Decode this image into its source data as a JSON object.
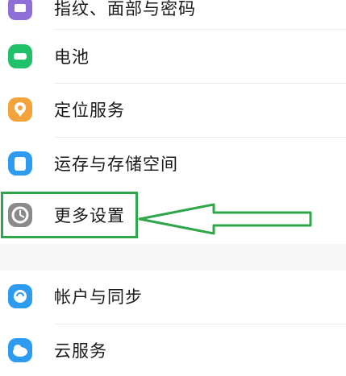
{
  "settings": {
    "items": [
      {
        "label": "指纹、面部与密码",
        "icon": "fingerprint-lock-icon",
        "color": "#8e6fd8"
      },
      {
        "label": "电池",
        "icon": "battery-icon",
        "color": "#21c06b"
      },
      {
        "label": "定位服务",
        "icon": "location-pin-icon",
        "color": "#f2a33c"
      },
      {
        "label": "运存与存储空间",
        "icon": "storage-icon",
        "color": "#2c9bf0"
      },
      {
        "label": "更多设置",
        "icon": "more-settings-gear-icon",
        "color": "#8a8a8a"
      },
      {
        "label": "帐户与同步",
        "icon": "account-sync-icon",
        "color": "#2c9bf0"
      },
      {
        "label": "云服务",
        "icon": "cloud-service-icon",
        "color": "#2c9bf0"
      }
    ]
  },
  "annotation": {
    "color": "#2fa64a"
  }
}
